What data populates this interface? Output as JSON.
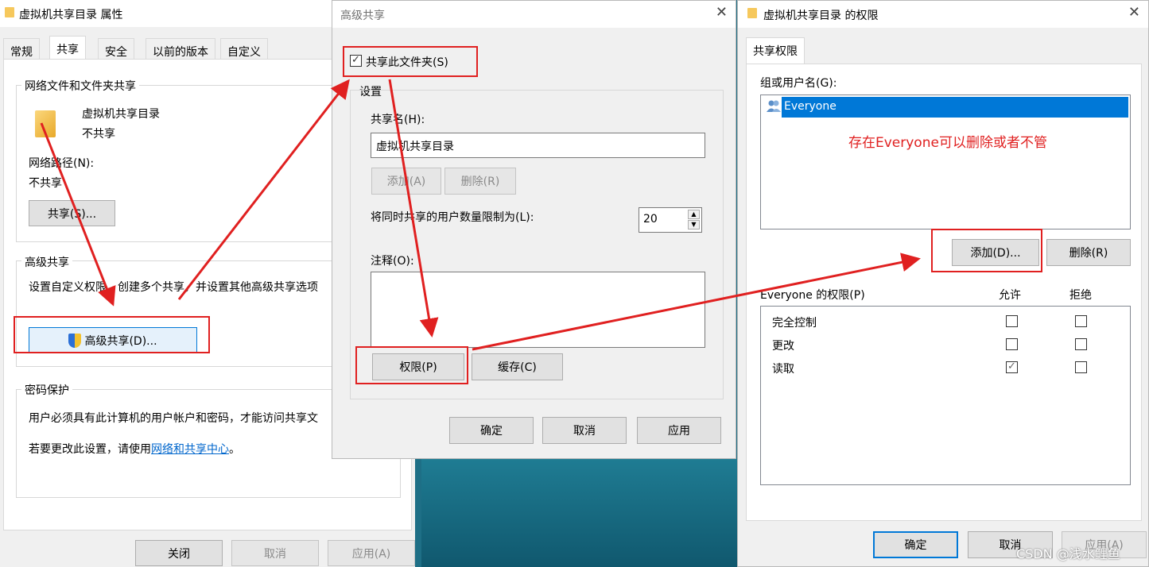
{
  "properties": {
    "title": "虚拟机共享目录 属性",
    "tabs": [
      "常规",
      "共享",
      "安全",
      "以前的版本",
      "自定义"
    ],
    "net_share_group": "网络文件和文件夹共享",
    "folder_name": "虚拟机共享目录",
    "share_state": "不共享",
    "net_path_label": "网络路径(N):",
    "net_path_value": "不共享",
    "share_button": "共享(S)...",
    "adv_group": "高级共享",
    "adv_desc": "设置自定义权限，创建多个共享，并设置其他高级共享选项",
    "adv_button": "高级共享(D)...",
    "pwd_group": "密码保护",
    "pwd_desc": "用户必须具有此计算机的用户帐户和密码，才能访问共享文",
    "pwd_change_prefix": "若要更改此设置，请使用",
    "pwd_link": "网络和共享中心",
    "pwd_change_suffix": "。",
    "close_button": "关闭",
    "cancel_button": "取消",
    "apply_button": "应用(A)"
  },
  "advanced": {
    "title": "高级共享",
    "share_checkbox": "共享此文件夹(S)",
    "settings_group": "设置",
    "share_name_label": "共享名(H):",
    "share_name_value": "虚拟机共享目录",
    "add_button": "添加(A)",
    "remove_button": "删除(R)",
    "limit_label": "将同时共享的用户数量限制为(L):",
    "limit_value": "20",
    "comment_label": "注释(O):",
    "permissions_button": "权限(P)",
    "cache_button": "缓存(C)",
    "ok_button": "确定",
    "cancel_button": "取消",
    "apply_button": "应用"
  },
  "permissions": {
    "title": "虚拟机共享目录 的权限",
    "tab": "共享权限",
    "group_label": "组或用户名(G):",
    "selected_user": "Everyone",
    "annotation": "存在Everyone可以删除或者不管",
    "add_button": "添加(D)...",
    "remove_button": "删除(R)",
    "perm_label": "Everyone 的权限(P)",
    "allow_header": "允许",
    "deny_header": "拒绝",
    "rows": [
      {
        "name": "完全控制",
        "allow": false,
        "deny": false
      },
      {
        "name": "更改",
        "allow": false,
        "deny": false
      },
      {
        "name": "读取",
        "allow": true,
        "deny": false
      }
    ],
    "ok_button": "确定",
    "cancel_button": "取消",
    "apply_button": "应用(A)"
  },
  "watermark": "CSDN @浅水鲤鱼",
  "colors": {
    "annotation_red": "#e02020",
    "selection_blue": "#0078d7",
    "link_blue": "#0066cc"
  }
}
